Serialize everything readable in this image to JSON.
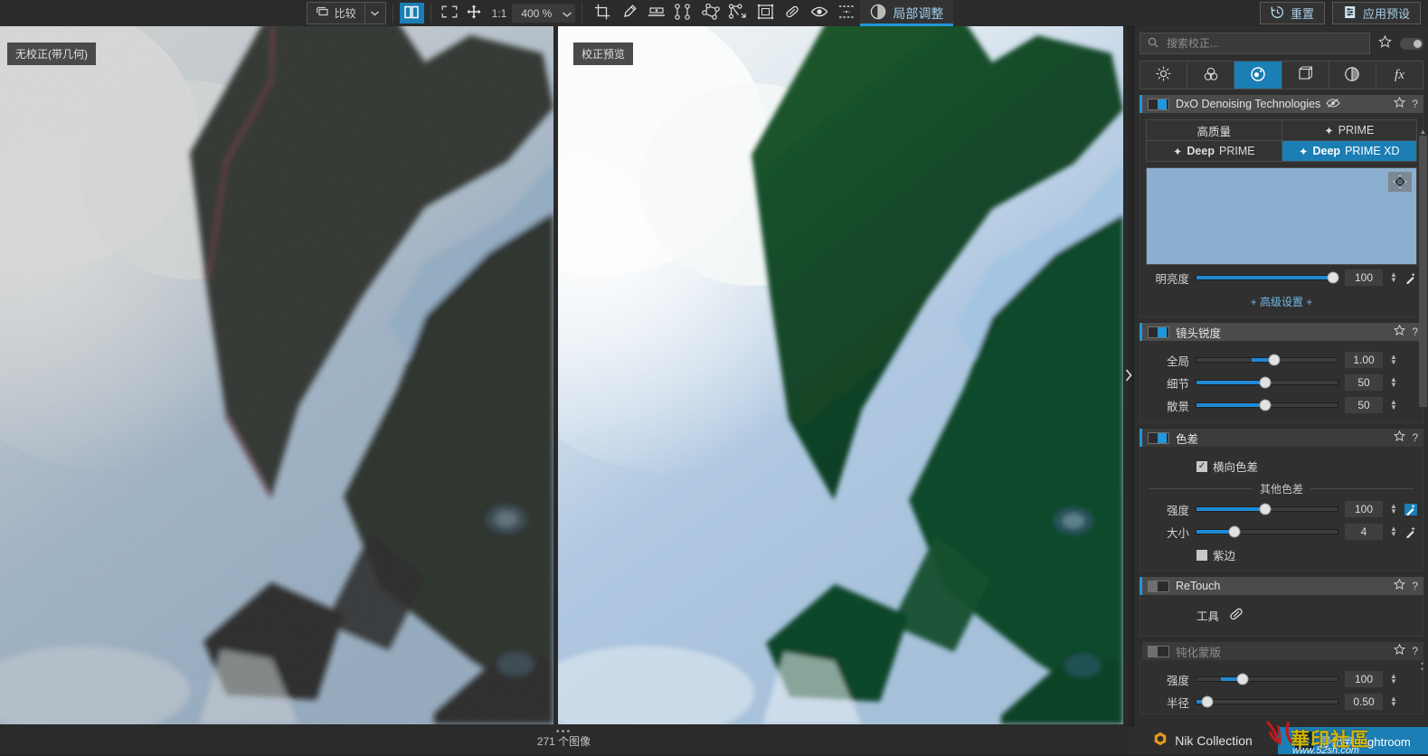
{
  "toolbar": {
    "compare_label": "比较",
    "compare_icon": "compare-icon",
    "dropdown_icon": "chevron-down-icon",
    "split_view_icon": "split-view-icon",
    "fit_icon": "fit-to-screen-icon",
    "pan_icon": "pan-move-icon",
    "ratio_label": "1:1",
    "zoom_value": "400 %",
    "zoom_arrow_icon": "chevron-down-icon",
    "tools": [
      {
        "name": "crop-icon"
      },
      {
        "name": "color-picker-icon"
      },
      {
        "name": "horizon-level-icon"
      },
      {
        "name": "perspective-2point-icon"
      },
      {
        "name": "perspective-4point-icon"
      },
      {
        "name": "perspective-rectangle-icon"
      },
      {
        "name": "perspective-grid-icon"
      },
      {
        "name": "repair-eraser-icon"
      },
      {
        "name": "preview-eye-icon"
      },
      {
        "name": "dashed-frame-icon"
      }
    ],
    "local_adjust_label": "局部调整",
    "local_adjust_icon": "local-adjustment-icon",
    "reset_label": "重置",
    "reset_icon": "history-reset-icon",
    "apply_preset_label": "应用预设",
    "apply_preset_icon": "preset-list-icon"
  },
  "viewer": {
    "left_badge": "无校正(带几何)",
    "right_badge": "校正预览",
    "status_text": "271 个图像",
    "handle_icon": "drag-dots-icon"
  },
  "panel": {
    "search": {
      "placeholder": "搜索校正...",
      "value": "",
      "icon": "search-icon"
    },
    "favorite_icon": "star-icon",
    "toggle_icon": "toggle-switch-icon",
    "categories": [
      {
        "name": "light-icon",
        "active": false
      },
      {
        "name": "color-icon",
        "active": false
      },
      {
        "name": "detail-icon",
        "active": true
      },
      {
        "name": "geometry-icon",
        "active": false
      },
      {
        "name": "local-contrast-icon",
        "active": false
      },
      {
        "name": "effects-fx-icon",
        "active": false
      }
    ],
    "sections": [
      {
        "title": "DxO Denoising Technologies",
        "enabled": true,
        "eye_icon": "eye-off-icon",
        "star_icon": "star-icon",
        "help_icon": "question-mark-icon",
        "modes_row1": [
          {
            "label": "高质量",
            "selected": false,
            "icon": null
          },
          {
            "label": "PRIME",
            "selected": false,
            "icon": "sparkle-icon"
          }
        ],
        "modes_row2": [
          {
            "label": "DeepPRIME",
            "bold": "Deep",
            "rest": "PRIME",
            "selected": false,
            "icon": "sparkle-icon"
          },
          {
            "label": "DeepPRIME XD",
            "bold": "Deep",
            "rest": "PRIME XD",
            "selected": true,
            "icon": "sparkle-icon"
          }
        ],
        "preview_loupe_icon": "loupe-target-icon",
        "preview_color": "#8dafcf",
        "sliders": [
          {
            "label": "明亮度",
            "value": "100",
            "pct": 97,
            "origin": "left",
            "wand": false
          }
        ],
        "advanced_label": "+ 高级设置 +"
      },
      {
        "title": "镜头锐度",
        "enabled": true,
        "star_icon": "star-icon",
        "help_icon": "question-mark-icon",
        "sliders": [
          {
            "label": "全局",
            "value": "1.00",
            "pct": 55,
            "origin": "center",
            "wand": false
          },
          {
            "label": "细节",
            "value": "50",
            "pct": 49,
            "origin": "left",
            "wand": false
          },
          {
            "label": "散景",
            "value": "50",
            "pct": 49,
            "origin": "left",
            "wand": false
          }
        ]
      },
      {
        "title": "色差",
        "enabled": true,
        "star_icon": "star-icon",
        "help_icon": "question-mark-icon",
        "checkbox_top": {
          "label": "横向色差",
          "checked": true
        },
        "sub_header": "其他色差",
        "sliders": [
          {
            "label": "强度",
            "value": "100",
            "pct": 49,
            "origin": "left",
            "wand": true,
            "wand_active": true
          },
          {
            "label": "大小",
            "value": "4",
            "pct": 27,
            "origin": "left",
            "wand": true,
            "wand_active": false
          }
        ],
        "checkbox_bottom": {
          "label": "紫边",
          "checked": false
        }
      },
      {
        "title": "ReTouch",
        "enabled": true,
        "star_icon": "star-icon",
        "help_icon": "question-mark-icon",
        "tool_label": "工具",
        "tool_icon": "repair-eraser-icon"
      },
      {
        "title": "钝化蒙版",
        "enabled": false,
        "star_icon": "star-icon",
        "help_icon": "question-mark-icon",
        "sliders": [
          {
            "label": "强度",
            "value": "100",
            "pct": 33,
            "origin": "left",
            "wand": false
          },
          {
            "label": "半径",
            "value": "0.50",
            "pct": 8,
            "origin": "left",
            "wand": false
          }
        ]
      }
    ],
    "scrollbar": {
      "up_icon": "scroll-up-icon",
      "down_icon": "scroll-down-icon",
      "grip_icon": "scroll-grip-icon"
    }
  },
  "bottom": {
    "nik_label": "Nik Collection",
    "nik_icon": "nik-hexagon-icon",
    "export_label": "导出到 Lightroom",
    "export_icon": "lightroom-lrc-icon"
  },
  "watermark": {
    "title": "華印社區",
    "subtitle": "www.52sh.com"
  }
}
